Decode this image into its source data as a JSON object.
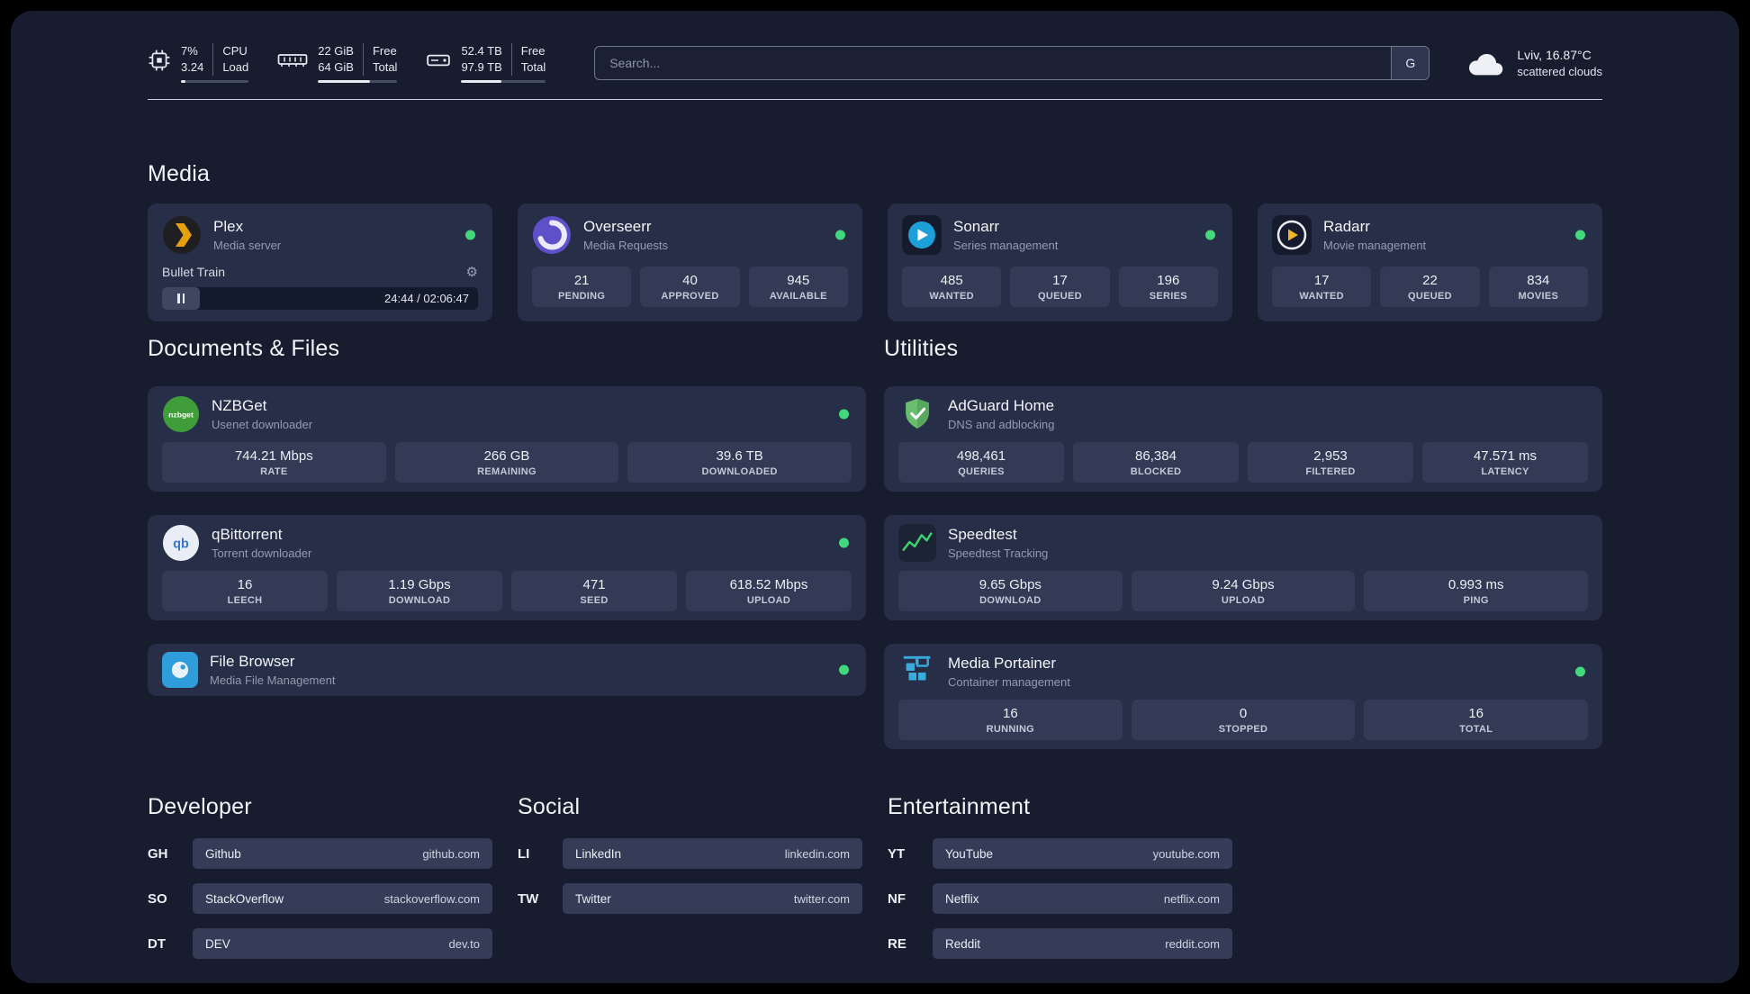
{
  "colors": {
    "status_online": "#41d97c"
  },
  "topbar": {
    "cpu": {
      "value_top": "7%",
      "value_bottom": "3.24",
      "label_top": "CPU",
      "label_bottom": "Load",
      "bar_percent": 7
    },
    "memory": {
      "value_top": "22 GiB",
      "value_bottom": "64 GiB",
      "label_top": "Free",
      "label_bottom": "Total",
      "bar_percent": 66
    },
    "disk": {
      "value_top": "52.4 TB",
      "value_bottom": "97.9 TB",
      "label_top": "Free",
      "label_bottom": "Total",
      "bar_percent": 47
    },
    "search": {
      "placeholder": "Search...",
      "button_label": "G"
    },
    "weather": {
      "location": "Lviv, 16.87°C",
      "condition": "scattered clouds"
    }
  },
  "sections": {
    "media": {
      "title": "Media",
      "plex": {
        "name": "Plex",
        "subtitle": "Media server",
        "status": "online",
        "now_playing": "Bullet Train",
        "time": "24:44 / 02:06:47"
      },
      "overseerr": {
        "name": "Overseerr",
        "subtitle": "Media Requests",
        "status": "online",
        "stats": [
          {
            "value": "21",
            "label": "PENDING"
          },
          {
            "value": "40",
            "label": "APPROVED"
          },
          {
            "value": "945",
            "label": "AVAILABLE"
          }
        ]
      },
      "sonarr": {
        "name": "Sonarr",
        "subtitle": "Series management",
        "status": "online",
        "stats": [
          {
            "value": "485",
            "label": "WANTED"
          },
          {
            "value": "17",
            "label": "QUEUED"
          },
          {
            "value": "196",
            "label": "SERIES"
          }
        ]
      },
      "radarr": {
        "name": "Radarr",
        "subtitle": "Movie management",
        "status": "online",
        "stats": [
          {
            "value": "17",
            "label": "WANTED"
          },
          {
            "value": "22",
            "label": "QUEUED"
          },
          {
            "value": "834",
            "label": "MOVIES"
          }
        ]
      }
    },
    "documents": {
      "title": "Documents & Files",
      "nzbget": {
        "name": "NZBGet",
        "subtitle": "Usenet downloader",
        "status": "online",
        "icon_text": "nzbget",
        "stats": [
          {
            "value": "744.21 Mbps",
            "label": "RATE"
          },
          {
            "value": "266 GB",
            "label": "REMAINING"
          },
          {
            "value": "39.6 TB",
            "label": "DOWNLOADED"
          }
        ]
      },
      "qbittorrent": {
        "name": "qBittorrent",
        "subtitle": "Torrent downloader",
        "status": "online",
        "icon_text": "qb",
        "stats": [
          {
            "value": "16",
            "label": "LEECH"
          },
          {
            "value": "1.19 Gbps",
            "label": "DOWNLOAD"
          },
          {
            "value": "471",
            "label": "SEED"
          },
          {
            "value": "618.52 Mbps",
            "label": "UPLOAD"
          }
        ]
      },
      "filebrowser": {
        "name": "File Browser",
        "subtitle": "Media File Management",
        "status": "online"
      }
    },
    "utilities": {
      "title": "Utilities",
      "adguard": {
        "name": "AdGuard Home",
        "subtitle": "DNS and adblocking",
        "stats": [
          {
            "value": "498,461",
            "label": "QUERIES"
          },
          {
            "value": "86,384",
            "label": "BLOCKED"
          },
          {
            "value": "2,953",
            "label": "FILTERED"
          },
          {
            "value": "47.571 ms",
            "label": "LATENCY"
          }
        ]
      },
      "speedtest": {
        "name": "Speedtest",
        "subtitle": "Speedtest Tracking",
        "stats": [
          {
            "value": "9.65 Gbps",
            "label": "DOWNLOAD"
          },
          {
            "value": "9.24 Gbps",
            "label": "UPLOAD"
          },
          {
            "value": "0.993 ms",
            "label": "PING"
          }
        ]
      },
      "portainer": {
        "name": "Media Portainer",
        "subtitle": "Container management",
        "status": "online",
        "stats": [
          {
            "value": "16",
            "label": "RUNNING"
          },
          {
            "value": "0",
            "label": "STOPPED"
          },
          {
            "value": "16",
            "label": "TOTAL"
          }
        ]
      }
    },
    "bookmarks": {
      "developer": {
        "title": "Developer",
        "items": [
          {
            "abbr": "GH",
            "name": "Github",
            "url": "github.com"
          },
          {
            "abbr": "SO",
            "name": "StackOverflow",
            "url": "stackoverflow.com"
          },
          {
            "abbr": "DT",
            "name": "DEV",
            "url": "dev.to"
          }
        ]
      },
      "social": {
        "title": "Social",
        "items": [
          {
            "abbr": "LI",
            "name": "LinkedIn",
            "url": "linkedin.com"
          },
          {
            "abbr": "TW",
            "name": "Twitter",
            "url": "twitter.com"
          }
        ]
      },
      "entertainment": {
        "title": "Entertainment",
        "items": [
          {
            "abbr": "YT",
            "name": "YouTube",
            "url": "youtube.com"
          },
          {
            "abbr": "NF",
            "name": "Netflix",
            "url": "netflix.com"
          },
          {
            "abbr": "RE",
            "name": "Reddit",
            "url": "reddit.com"
          }
        ]
      }
    }
  }
}
